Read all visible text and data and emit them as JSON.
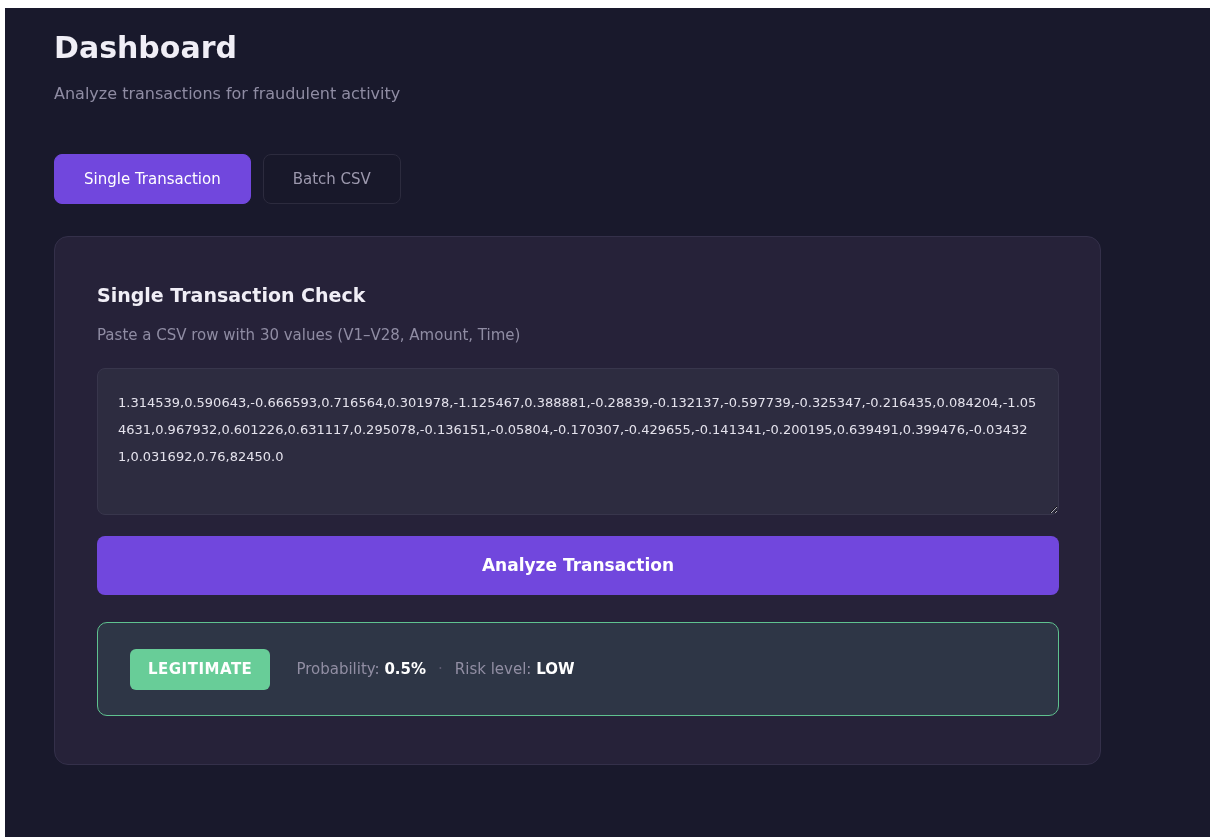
{
  "page": {
    "title": "Dashboard",
    "subtitle": "Analyze transactions for fraudulent activity"
  },
  "tabs": [
    {
      "label": "Single Transaction",
      "selected": true
    },
    {
      "label": "Batch CSV",
      "selected": false
    }
  ],
  "card": {
    "title": "Single Transaction Check",
    "hint": "Paste a CSV row with 30 values (V1–V28, Amount, Time)",
    "input": {
      "value": "1.314539,0.590643,-0.666593,0.716564,0.301978,-1.125467,0.388881,-0.28839,-0.132137,-0.597739,-0.325347,-0.216435,0.084204,-1.054631,0.967932,0.601226,0.631117,0.295078,-0.136151,-0.05804,-0.170307,-0.429655,-0.141341,-0.200195,0.639491,0.399476,-0.034321,0.031692,0.76,82450.0"
    },
    "button": "Analyze Transaction",
    "result": {
      "kind": "legitimate",
      "verdict": "LEGITIMATE",
      "probability": "Probability: **0.5%**",
      "separator": "·",
      "risk": "Risk level: **LOW**"
    }
  }
}
